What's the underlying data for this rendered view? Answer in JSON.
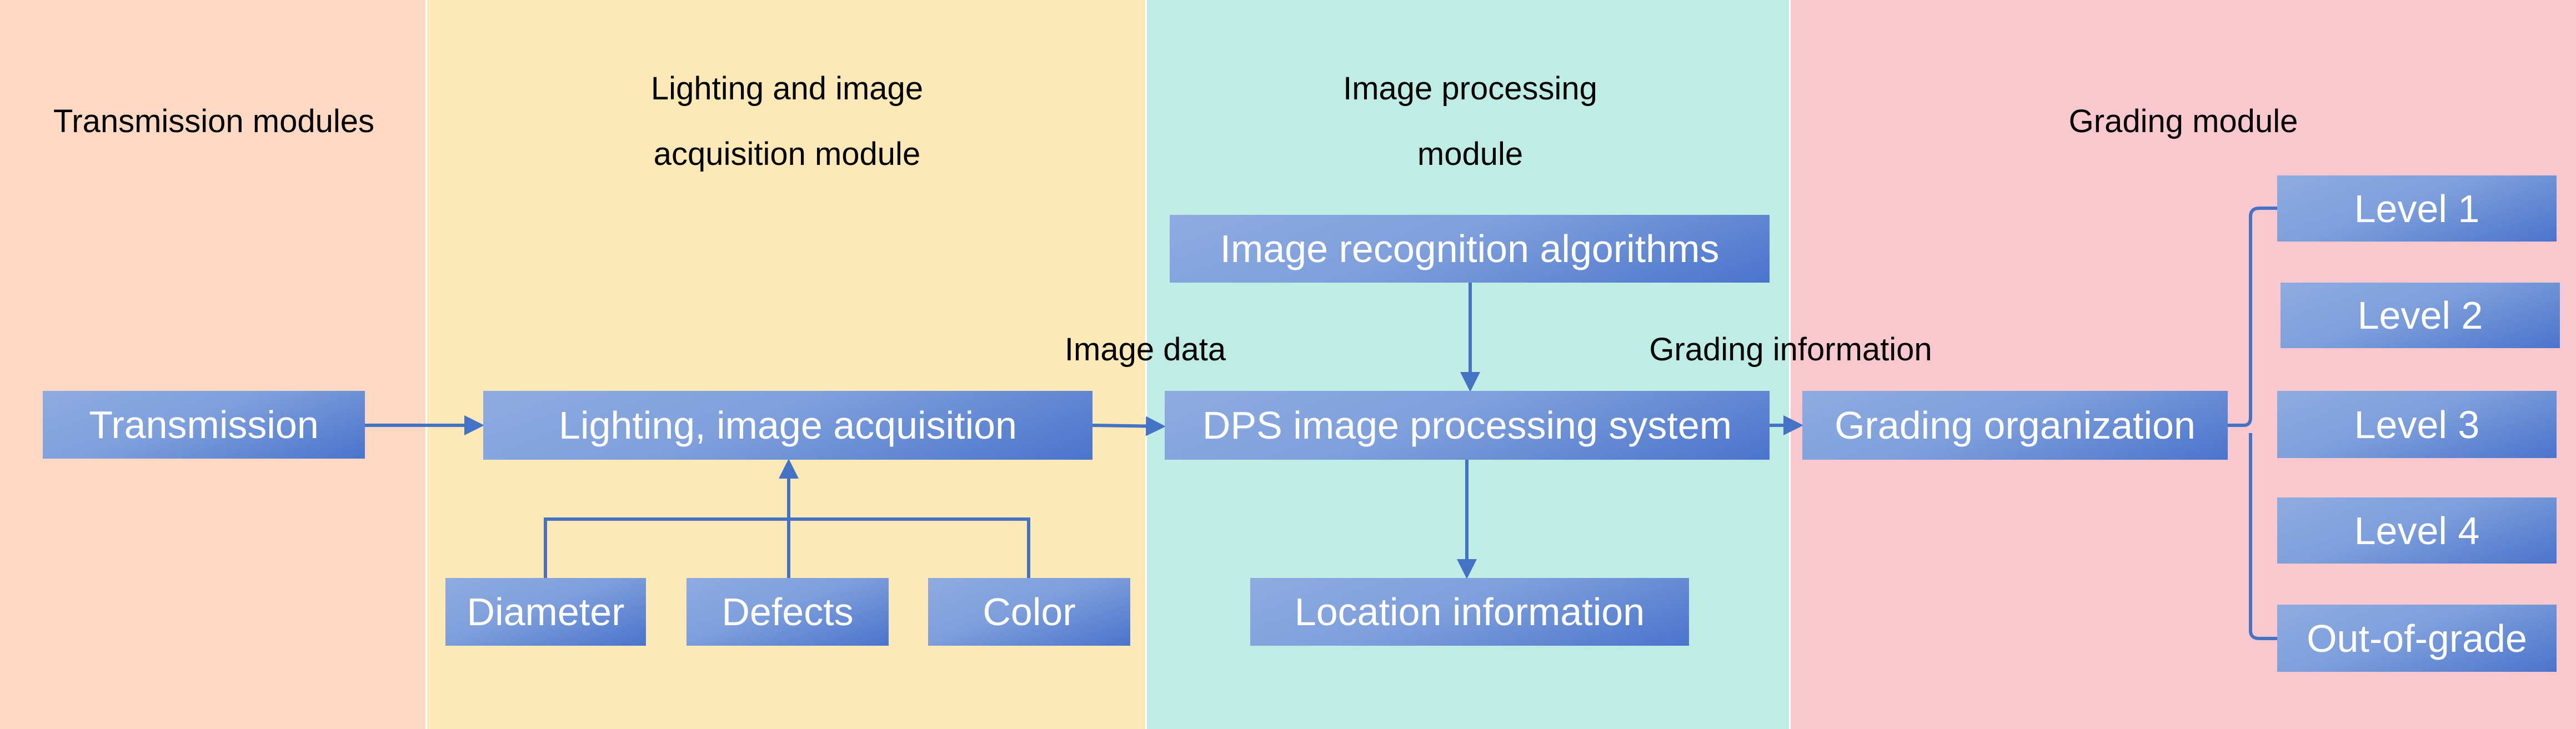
{
  "colors": {
    "box_gradient_start": "#8fabe0",
    "box_gradient_end": "#4a74cc",
    "connector": "#4472c4",
    "transmission_bg": "#fdd9c4",
    "lighting_bg": "#fde9b8",
    "processing_bg": "#bfede6",
    "grading_bg": "#f8c8ce"
  },
  "columns": [
    {
      "title": [
        "Transmission modules"
      ]
    },
    {
      "title": [
        "Lighting and image",
        "acquisition module"
      ]
    },
    {
      "title": [
        "Image processing",
        "module"
      ]
    },
    {
      "title": [
        "Grading module"
      ]
    }
  ],
  "nodes": {
    "transmission": "Transmission",
    "lighting": "Lighting, image acquisition",
    "diameter": "Diameter",
    "defects": "Defects",
    "color": "Color",
    "recognition": "Image recognition algorithms",
    "dps": "DPS image processing system",
    "location": "Location information",
    "grading": "Grading organization",
    "levels": [
      "Level 1",
      "Level 2",
      "Level 3",
      "Level 4",
      "Out-of-grade"
    ]
  },
  "edge_labels": {
    "image_data": "Image data",
    "grading_information": "Grading information"
  }
}
